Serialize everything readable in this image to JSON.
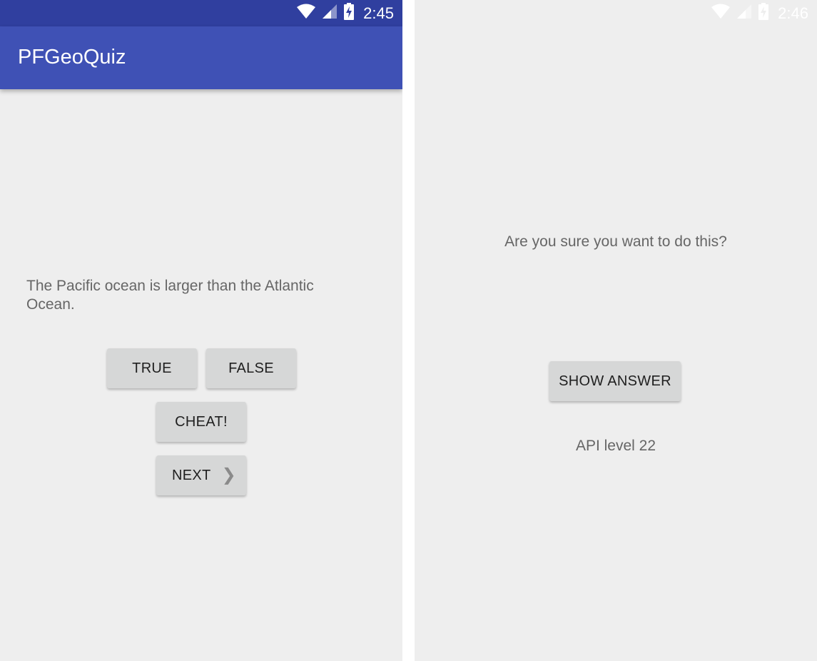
{
  "left_screen": {
    "status_bar": {
      "time": "2:45",
      "background_color": "#303f9f",
      "icons": [
        "wifi-icon",
        "cell-signal-icon",
        "battery-charging-icon"
      ]
    },
    "app_bar": {
      "title": "PFGeoQuiz",
      "background_color": "#3f51b5"
    },
    "question": "The Pacific ocean is larger than the Atlantic Ocean.",
    "buttons": {
      "true_label": "TRUE",
      "false_label": "FALSE",
      "cheat_label": "CHEAT!",
      "next_label": "NEXT",
      "next_icon": "chevron-right-icon"
    }
  },
  "right_screen": {
    "status_bar": {
      "time": "2:46",
      "icons": [
        "wifi-icon",
        "cell-signal-icon",
        "battery-charging-icon"
      ]
    },
    "confirm_text": "Are you sure you want to do this?",
    "show_answer_label": "SHOW ANSWER",
    "api_level_text": "API level 22"
  },
  "colors": {
    "background": "#eeeeee",
    "button": "#d6d7d7",
    "secondary_text": "#666666"
  }
}
